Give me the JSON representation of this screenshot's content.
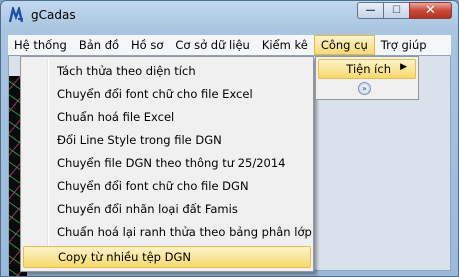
{
  "window": {
    "title": "gCadas",
    "minimize_glyph": "—",
    "maximize_glyph": "☐",
    "close_glyph": "✕"
  },
  "menubar": {
    "items": [
      "Hệ thống",
      "Bản đồ",
      "Hồ sơ",
      "Cơ sở dữ liệu",
      "Kiểm kê",
      "Công cụ",
      "Trợ giúp"
    ],
    "active": "Công cụ"
  },
  "dropdown": {
    "items": [
      "Tách thửa theo diện tích",
      "Chuyển đổi font chữ cho file Excel",
      "Chuẩn hoá file Excel",
      "Đổi Line Style trong file DGN",
      "Chuyển file DGN theo thông tư 25/2014",
      "Chuyển đổi font chữ cho file DGN",
      "Chuyển đổi nhãn loại đất Famis",
      "Chuẩn hoá lại ranh thửa theo bảng phân lớp",
      "Copy từ nhiều tệp DGN"
    ],
    "highlighted": "Copy từ nhiều tệp DGN"
  },
  "submenu": {
    "label": "Tiện ích",
    "arrow": "▶",
    "expand_glyph": "»"
  },
  "icons": [
    "app-icon",
    "expand-more-icon",
    "submenu-arrow-icon"
  ],
  "colors": {
    "highlight_top": "#fdf3c9",
    "highlight_bottom": "#f6d96e",
    "highlight_border": "#e5bd52",
    "menu_bg": "#f0f0f0"
  }
}
